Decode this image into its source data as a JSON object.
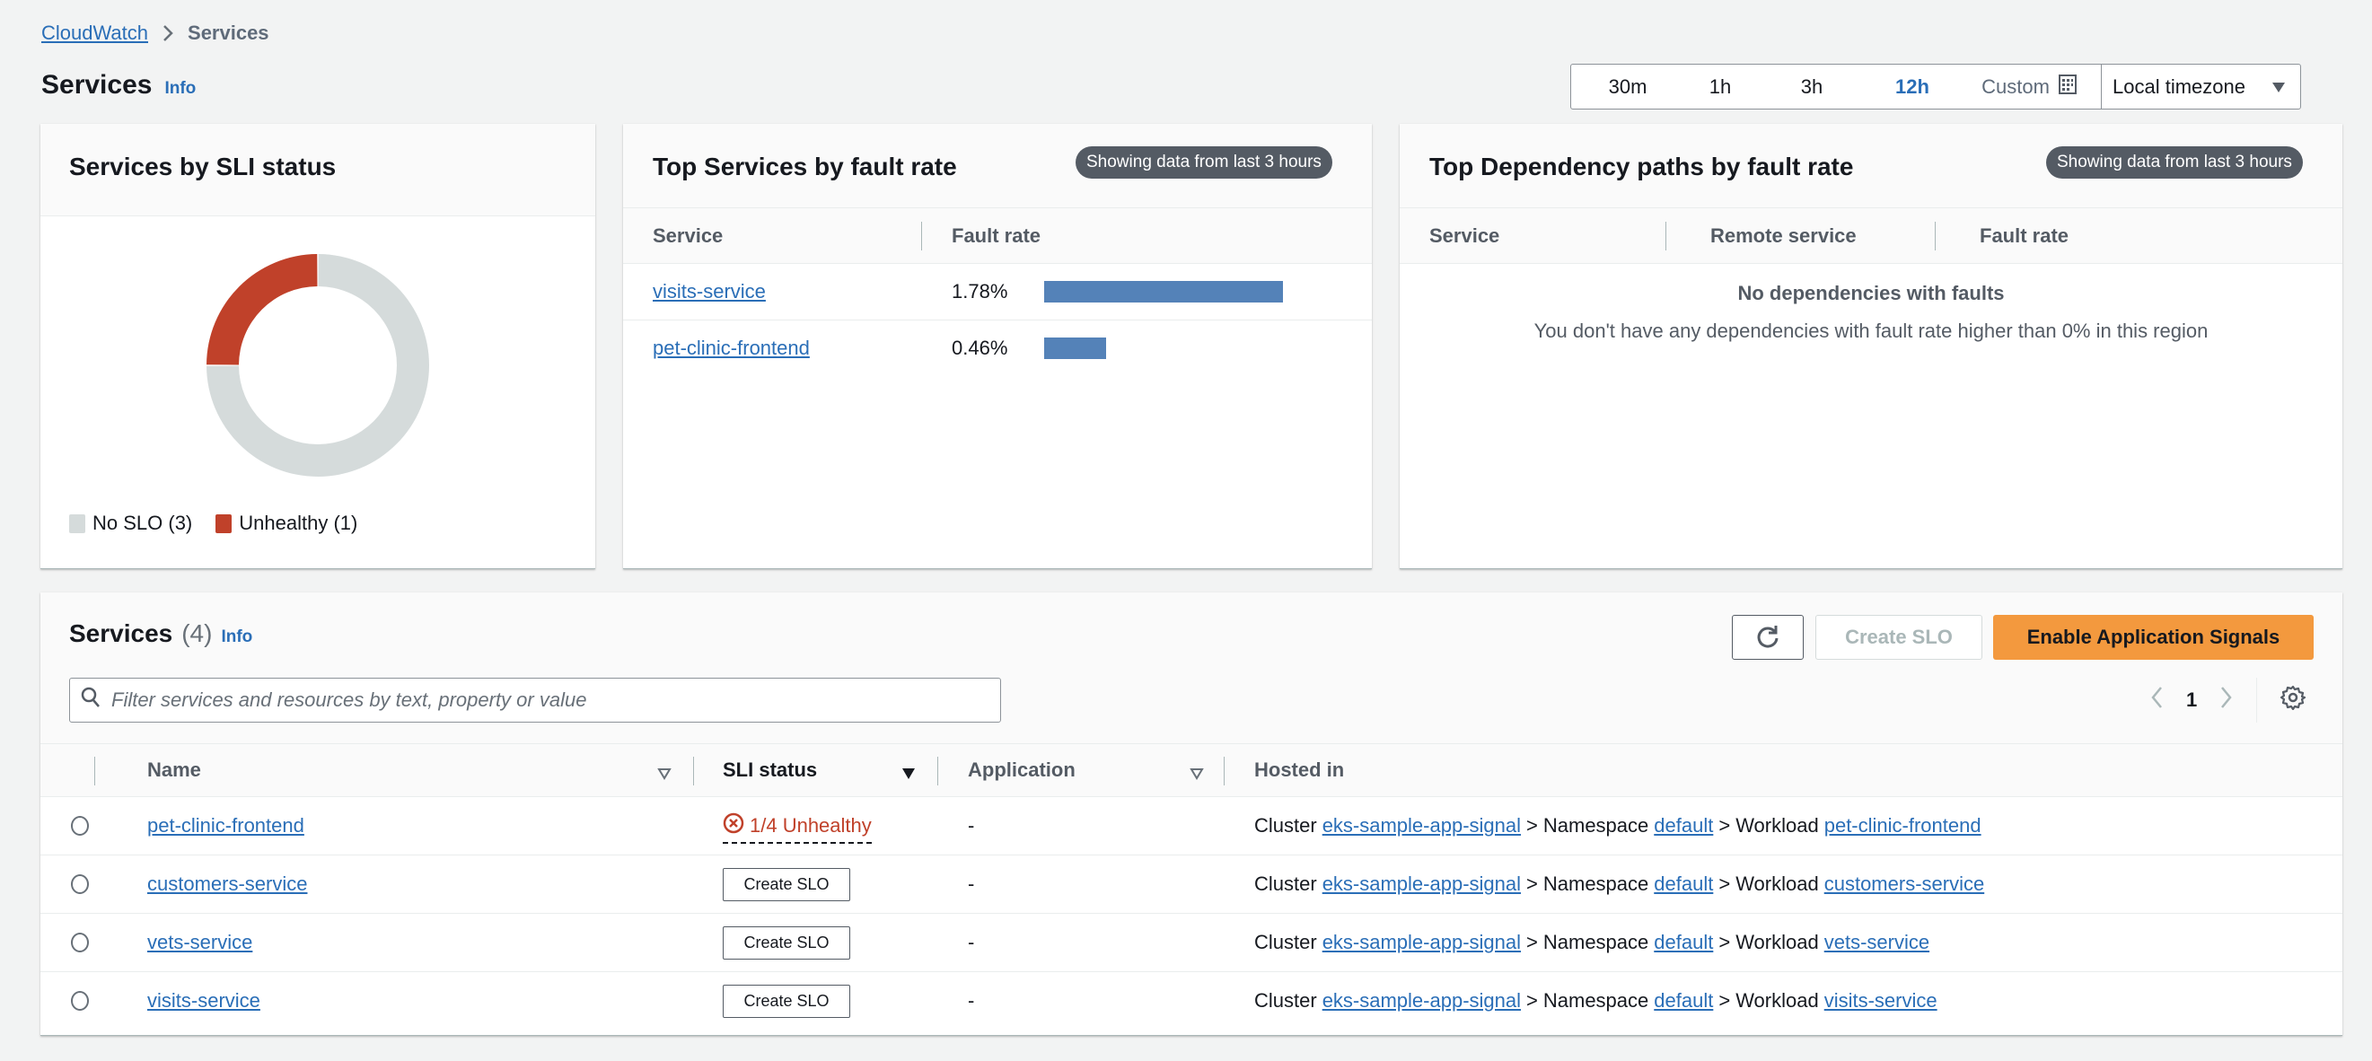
{
  "breadcrumb": {
    "root": "CloudWatch",
    "current": "Services"
  },
  "page": {
    "title": "Services",
    "info": "Info"
  },
  "time_range": {
    "options": [
      "30m",
      "1h",
      "3h",
      "12h"
    ],
    "selected": "12h",
    "custom_label": "Custom",
    "timezone": "Local timezone"
  },
  "sli_card": {
    "title": "Services by SLI status",
    "legend": [
      {
        "label": "No SLO (3)",
        "color": "#d5dbdb"
      },
      {
        "label": "Unhealthy (1)",
        "color": "#c0412a"
      }
    ]
  },
  "top_services_card": {
    "title": "Top Services by fault rate",
    "badge": "Showing data from last 3 hours",
    "columns": [
      "Service",
      "Fault rate"
    ],
    "rows": [
      {
        "service": "visits-service",
        "fault_rate": "1.78%",
        "value": 1.78
      },
      {
        "service": "pet-clinic-frontend",
        "fault_rate": "0.46%",
        "value": 0.46
      }
    ],
    "bar_color": "#5482b8"
  },
  "dependency_card": {
    "title": "Top Dependency paths by fault rate",
    "badge": "Showing data from last 3 hours",
    "columns": [
      "Service",
      "Remote service",
      "Fault rate"
    ],
    "empty_title": "No dependencies with faults",
    "empty_description": "You don't have any dependencies with fault rate higher than 0% in this region"
  },
  "services_table": {
    "title": "Services",
    "count": "(4)",
    "info": "Info",
    "filter_placeholder": "Filter services and resources by text, property or value",
    "filter_value": "",
    "buttons": {
      "create_slo": "Create SLO",
      "enable": "Enable Application Signals"
    },
    "pagination": {
      "current_page": "1"
    },
    "columns": [
      "Name",
      "SLI status",
      "Application",
      "Hosted in"
    ],
    "rows": [
      {
        "name": "pet-clinic-frontend",
        "sli_status": "1/4 Unhealthy",
        "sli_type": "unhealthy",
        "application": "-",
        "hosted": {
          "cluster_label": "Cluster",
          "cluster": "eks-sample-app-signal",
          "sep": ">",
          "namespace_label": "Namespace",
          "namespace": "default",
          "workload_label": "Workload",
          "workload": "pet-clinic-frontend"
        }
      },
      {
        "name": "customers-service",
        "sli_status": "Create SLO",
        "sli_type": "button",
        "application": "-",
        "hosted": {
          "cluster_label": "Cluster",
          "cluster": "eks-sample-app-signal",
          "sep": ">",
          "namespace_label": "Namespace",
          "namespace": "default",
          "workload_label": "Workload",
          "workload": "customers-service"
        }
      },
      {
        "name": "vets-service",
        "sli_status": "Create SLO",
        "sli_type": "button",
        "application": "-",
        "hosted": {
          "cluster_label": "Cluster",
          "cluster": "eks-sample-app-signal",
          "sep": ">",
          "namespace_label": "Namespace",
          "namespace": "default",
          "workload_label": "Workload",
          "workload": "vets-service"
        }
      },
      {
        "name": "visits-service",
        "sli_status": "Create SLO",
        "sli_type": "button",
        "application": "-",
        "hosted": {
          "cluster_label": "Cluster",
          "cluster": "eks-sample-app-signal",
          "sep": ">",
          "namespace_label": "Namespace",
          "namespace": "default",
          "workload_label": "Workload",
          "workload": "visits-service"
        }
      }
    ]
  },
  "chart_data": [
    {
      "type": "pie",
      "title": "Services by SLI status",
      "categories": [
        "Unhealthy",
        "No SLO"
      ],
      "values": [
        1,
        3
      ],
      "colors": [
        "#c0412a",
        "#d5dbdb"
      ],
      "donut": true,
      "legend": "bottom-left"
    },
    {
      "type": "bar",
      "title": "Top Services by fault rate",
      "categories": [
        "visits-service",
        "pet-clinic-frontend"
      ],
      "values": [
        1.78,
        0.46
      ],
      "unit": "%",
      "orientation": "horizontal"
    }
  ]
}
